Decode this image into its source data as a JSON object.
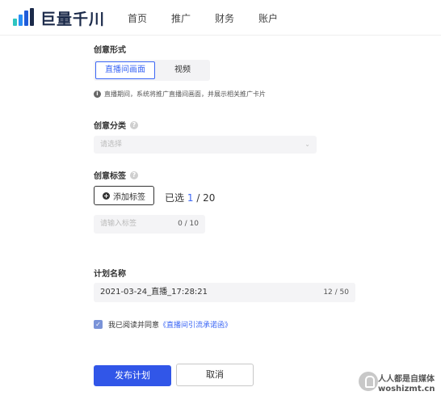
{
  "header": {
    "logo_text": "巨量千川",
    "nav": [
      "首页",
      "推广",
      "财务",
      "账户"
    ],
    "logo_colors": [
      "#2ec5c0",
      "#2a8ef5",
      "#1f5bd9",
      "#1b2a4a"
    ]
  },
  "creative_form": {
    "label": "创意形式",
    "options": [
      "直播间画面",
      "视频"
    ],
    "selected": "直播间画面",
    "info_text": "直播期间，系统将推广直播间画面，并展示相关推广卡片"
  },
  "creative_category": {
    "label": "创意分类",
    "placeholder": "请选择"
  },
  "creative_tags": {
    "label": "创意标签",
    "add_button": "添加标签",
    "selected_prefix": "已选",
    "selected_count": "1",
    "selected_total": "/ 20",
    "input_placeholder": "请输入标签",
    "input_counter": "0 / 10"
  },
  "plan_name": {
    "label": "计划名称",
    "value": "2021-03-24_直播_17:28:21",
    "counter": "12 / 50"
  },
  "agreement": {
    "checked": true,
    "text": "我已阅读并同意",
    "link": "《直播间引流承诺函》"
  },
  "actions": {
    "submit": "发布计划",
    "cancel": "取消"
  },
  "watermark": {
    "line1": "人人都是自媒体",
    "line2": "woshizmt.cn"
  },
  "colors": {
    "accent": "#3b66f5",
    "primary_button": "#3156e8"
  }
}
